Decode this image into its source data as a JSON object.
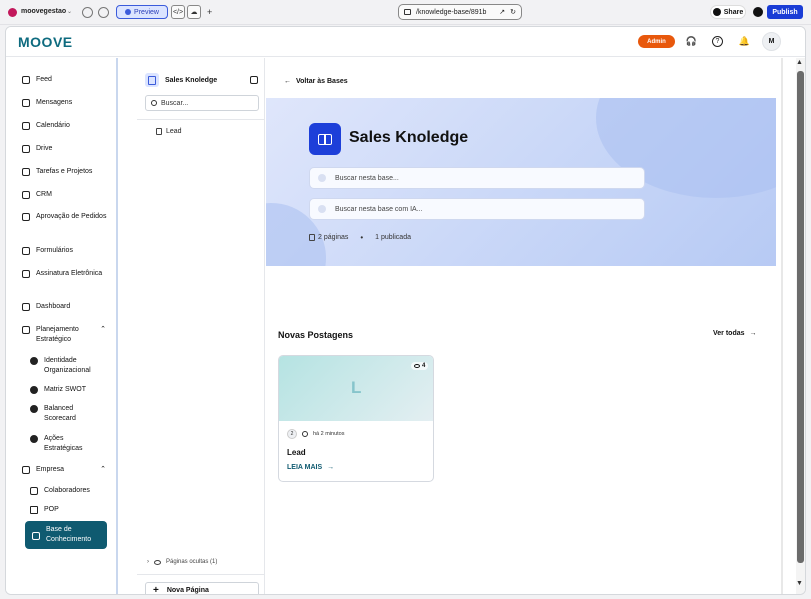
{
  "browser": {
    "workspace": "moovegestao",
    "preview_label": "Preview",
    "url": "/knowledge-base/891b",
    "share_label": "Share",
    "publish_label": "Publish"
  },
  "app": {
    "logo": "MOOVE",
    "admin_badge": "Admin",
    "avatar_initial": "M"
  },
  "sidebar": {
    "items": [
      {
        "label": "Feed"
      },
      {
        "label": "Mensagens"
      },
      {
        "label": "Calendário"
      },
      {
        "label": "Drive"
      },
      {
        "label": "Tarefas e Projetos"
      },
      {
        "label": "CRM"
      },
      {
        "label": "Aprovação de Pedidos"
      },
      {
        "label": "Formulários"
      },
      {
        "label": "Assinatura Eletrônica"
      },
      {
        "label": "Dashboard"
      },
      {
        "label": "Planejamento Estratégico"
      },
      {
        "label": "Empresa"
      }
    ],
    "planejamento_sub": [
      {
        "label": "Identidade Organizacional"
      },
      {
        "label": "Matriz SWOT"
      },
      {
        "label": "Balanced Scorecard"
      },
      {
        "label": "Ações Estratégicas"
      }
    ],
    "empresa_sub": [
      {
        "label": "Colaboradores"
      },
      {
        "label": "POP"
      },
      {
        "label": "Base de Conhecimento"
      }
    ]
  },
  "kpanel": {
    "title": "Sales Knoledge",
    "search_placeholder": "Buscar...",
    "pages": [
      {
        "label": "Lead"
      }
    ],
    "hidden_pages": "Páginas ocultas (1)",
    "new_page": "Nova Página"
  },
  "main": {
    "back": "Voltar às Bases",
    "hero_title": "Sales Knoledge",
    "search_placeholder": "Buscar nesta base...",
    "ai_placeholder": "Buscar nesta base com IA...",
    "pages_count": "2 páginas",
    "published": "1 publicada",
    "section_title": "Novas Postagens",
    "see_all": "Ver todas",
    "card": {
      "letter": "L",
      "views": "4",
      "author_initial": "2",
      "time": "há 2 minutos",
      "title": "Lead",
      "read_more": "LEIA MAIS"
    }
  }
}
